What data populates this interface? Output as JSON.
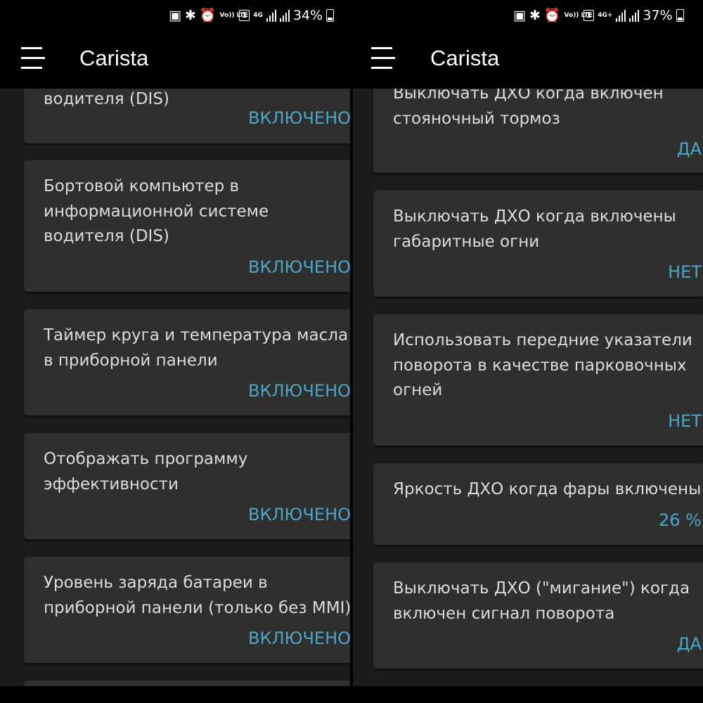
{
  "left": {
    "status": {
      "percent": "34%",
      "badge": "1",
      "volte": "Vo)) LTE",
      "network": "4G"
    },
    "app_title": "Carista",
    "cards": [
      {
        "title": "водителя (DIS)",
        "value": "ВКЛЮЧЕНО"
      },
      {
        "title": "Бортовой компьютер в информационной системе водителя (DIS)",
        "value": "ВКЛЮЧЕНО"
      },
      {
        "title": "Таймер круга и температура масла в приборной панели",
        "value": "ВКЛЮЧЕНО"
      },
      {
        "title": "Отображать программу эффективности",
        "value": "ВКЛЮЧЕНО"
      },
      {
        "title": "Уровень заряда батареи в приборной панели (только без MMI)",
        "value": "ВКЛЮЧЕНО"
      }
    ]
  },
  "right": {
    "status": {
      "percent": "37%",
      "badge": "1",
      "volte": "Vo)) LTE",
      "network": "4G+"
    },
    "app_title": "Carista",
    "cards": [
      {
        "title": "Выключать ДХО когда включен стояночный тормоз",
        "value": "ДА"
      },
      {
        "title": "Выключать ДХО когда включены габаритные огни",
        "value": "НЕТ"
      },
      {
        "title": "Использовать передние указатели поворота в качестве парковочных огней",
        "value": "НЕТ"
      },
      {
        "title": "Яркость ДХО когда фары включены",
        "value": "26 %"
      },
      {
        "title": "Выключать ДХО (\"мигание\") когда включен сигнал поворота",
        "value": "ДА"
      }
    ]
  },
  "colors": {
    "accent": "#4aa7c5",
    "card": "#2f2f2f",
    "background": "#1c1c1c",
    "text": "#dcdcdc"
  },
  "icons": [
    "sd-card-icon",
    "bluetooth-icon",
    "alarm-icon",
    "volte-icon",
    "sim-badge-icon",
    "signal-icon",
    "battery-icon",
    "menu-icon"
  ]
}
